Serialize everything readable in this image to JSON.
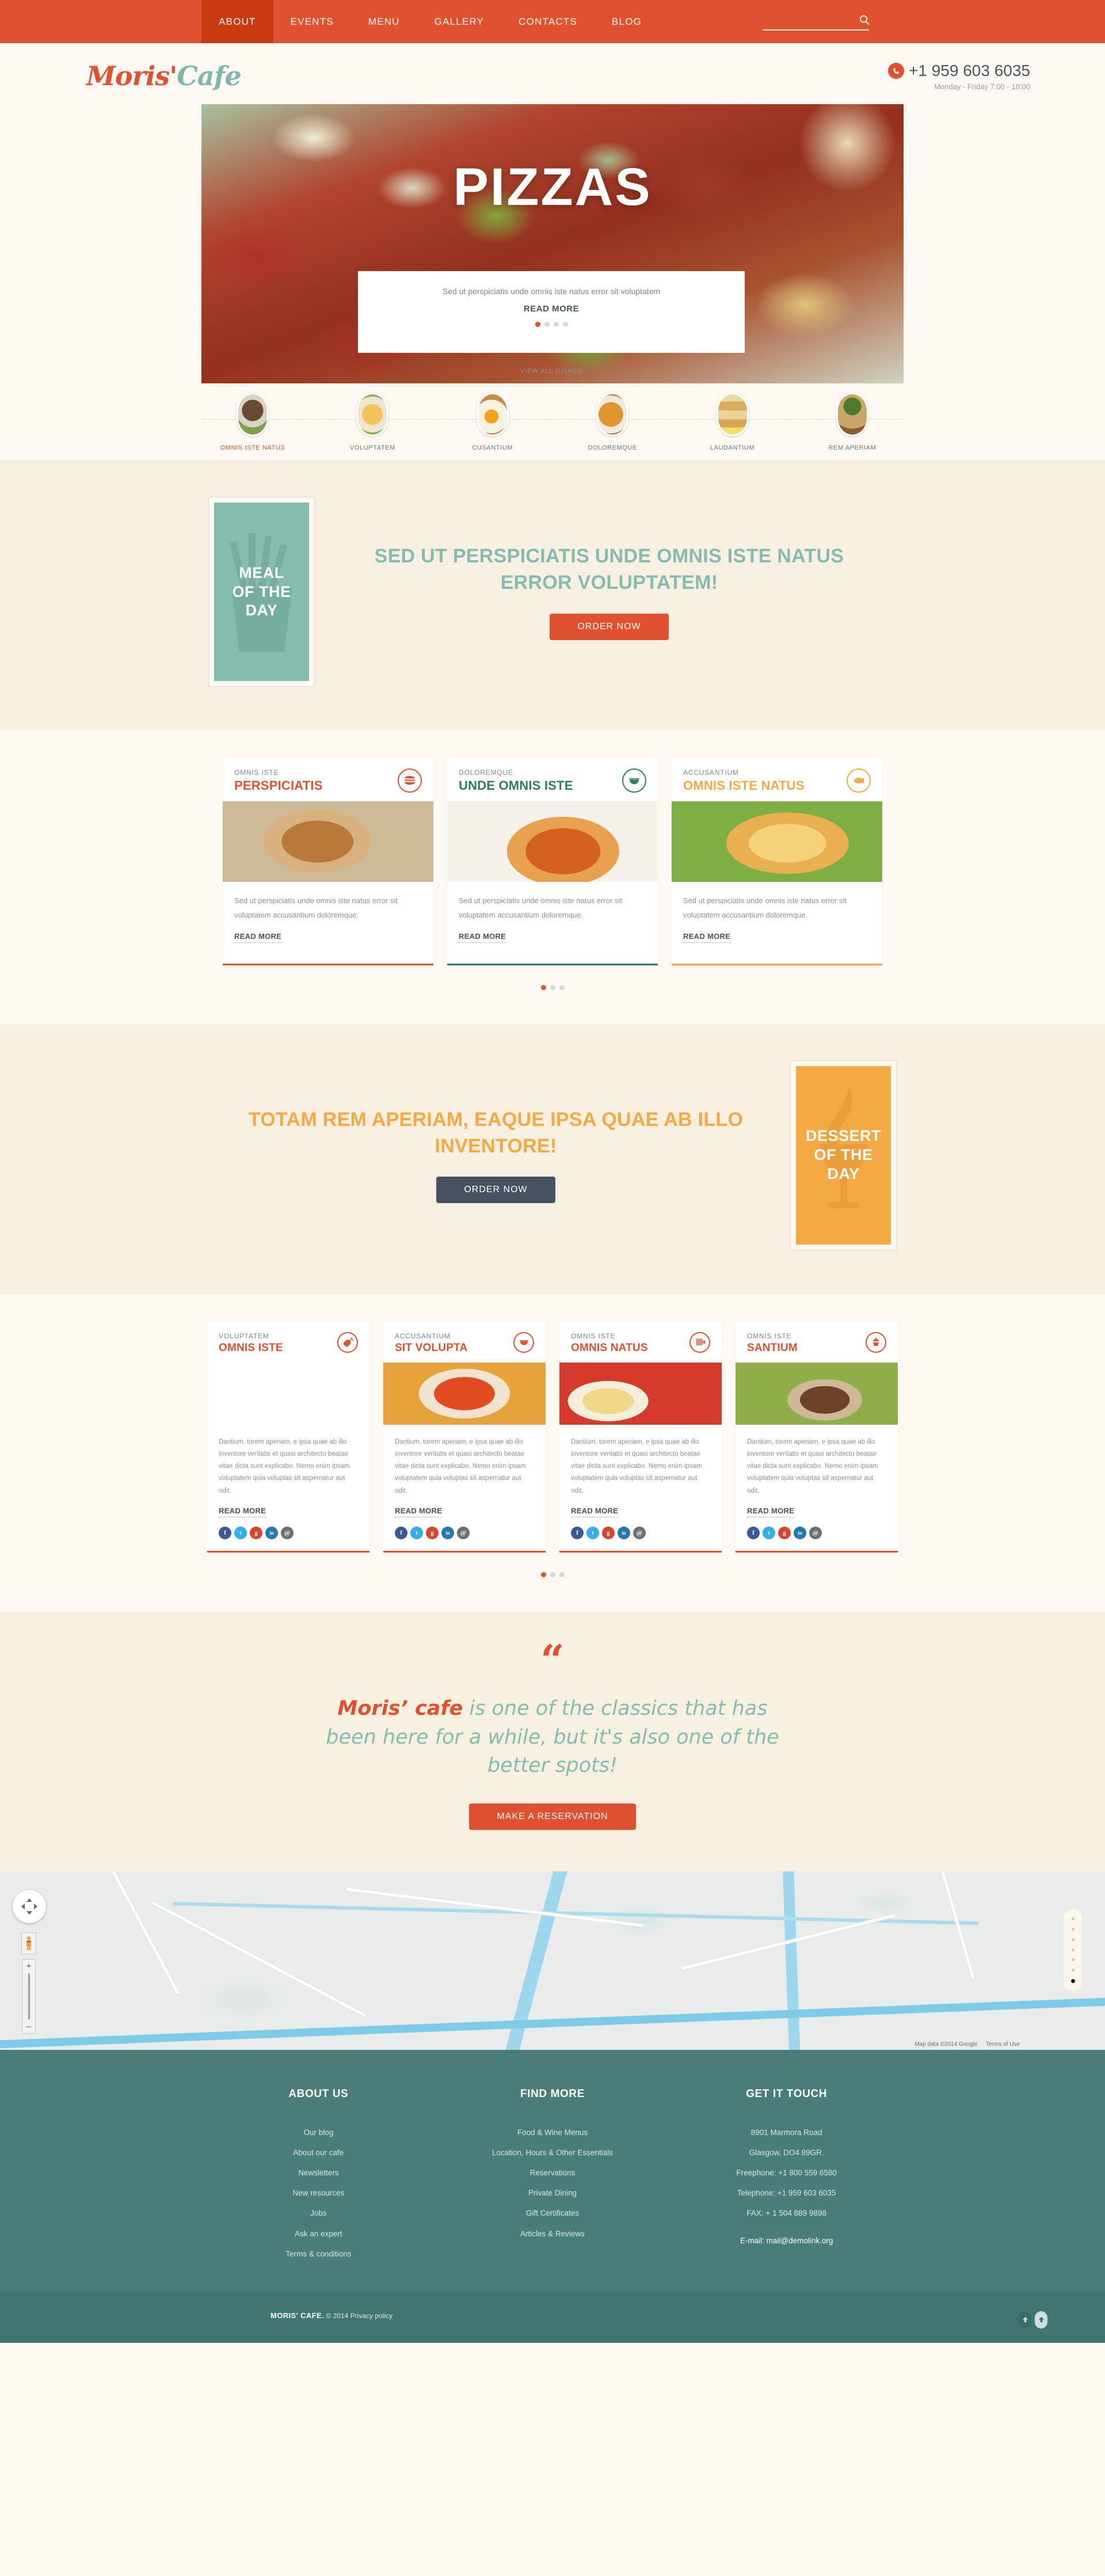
{
  "nav": {
    "items": [
      {
        "label": "ABOUT",
        "active": true
      },
      {
        "label": "EVENTS",
        "active": false
      },
      {
        "label": "MENU",
        "active": false
      },
      {
        "label": "GALLERY",
        "active": false
      },
      {
        "label": "CONTACTS",
        "active": false
      },
      {
        "label": "BLOG",
        "active": false
      }
    ],
    "search_placeholder": "",
    "search_value": ""
  },
  "brand": {
    "name_part1": "Moris'",
    "name_part2": "Cafe",
    "phone": "+1 959 603 6035",
    "hours": "Monday - Friday 7:00 - 18:00"
  },
  "hero": {
    "title": "PIZZAS",
    "lead": "Sed ut perspiciatis unde omnis iste natus error sit voluptatem",
    "read_more": "READ MORE",
    "view_all": "VIEW ALL DISHES",
    "dot_count": 4,
    "dot_active": 0
  },
  "categories": [
    {
      "label": "OMNIS ISTE NATUS",
      "active": true
    },
    {
      "label": "VOLUPTATEM",
      "active": false
    },
    {
      "label": "CUSANTIUM",
      "active": false
    },
    {
      "label": "DOLOREMQUE",
      "active": false
    },
    {
      "label": "LAUDANTIUM",
      "active": false
    },
    {
      "label": "REM APERIAM",
      "active": false
    }
  ],
  "promo_meal": {
    "box_label_line1": "MEAL",
    "box_label_line2": "OF THE DAY",
    "heading": "SED UT PERSPICIATIS UNDE OMNIS ISTE NATUS ERROR VOLUPTATEM!",
    "button": "ORDER NOW",
    "accent": "#84bdb0"
  },
  "promo_dessert": {
    "box_label_line1": "DESSERT",
    "box_label_line2": "OF THE DAY",
    "heading": "TOTAM REM APERIAM, EAQUE IPSA QUAE AB ILLO INVENTORE!",
    "button": "ORDER NOW",
    "accent": "#f4a942"
  },
  "dishes_three": {
    "cards": [
      {
        "kicker": "OMNIS ISTE",
        "title": "PERSPICIATIS",
        "desc": "Sed ut perspiciatis unde omnis iste natus error sit voluptatem accusantium doloremque.",
        "read_more": "READ MORE",
        "accent": "#e0512f",
        "icon": "burger-icon"
      },
      {
        "kicker": "DOLOREMQUE",
        "title": "UNDE OMNIS ISTE",
        "desc": "Sed ut perspiciatis unde omnis iste natus error sit voluptatem accusantium doloremque.",
        "read_more": "READ MORE",
        "accent": "#2e7d5b",
        "icon": "soup-icon"
      },
      {
        "kicker": "ACCUSANTIUM",
        "title": "OMNIS ISTE NATUS",
        "desc": "Sed ut perspiciatis unde omnis iste natus error sit voluptatem accusantium doloremque.",
        "read_more": "READ MORE",
        "accent": "#f4a942",
        "icon": "fish-icon"
      }
    ],
    "dot_count": 3,
    "dot_active": 0
  },
  "dishes_four": {
    "cards": [
      {
        "kicker": "VOLUPTATEM",
        "title": "OMNIS ISTE",
        "desc": "Dantium, torem aperiam, e ipsa quae ab illo inventore veritatis et quasi architecto beatae vitae dicta sunt explicabo. Nemo enim ipsam voluptatem quia voluptas sit aspernatur aut odit.",
        "read_more": "READ MORE",
        "accent": "#e0512f",
        "icon": "meat-leg-icon"
      },
      {
        "kicker": "ACCUSANTIUM",
        "title": "SIT VOLUPTA",
        "desc": "Dantium, torem aperiam, e ipsa quae ab illo inventore veritatis et quasi architecto beatae vitae dicta sunt explicabo. Nemo enim ipsam voluptatem quia voluptas sit aspernatur aut odit.",
        "read_more": "READ MORE",
        "accent": "#e0512f",
        "icon": "soup-icon"
      },
      {
        "kicker": "OMNIS ISTE",
        "title": "OMNIS NATUS",
        "desc": "Dantium, torem aperiam, e ipsa quae ab illo inventore veritatis et quasi architecto beatae vitae dicta sunt explicabo. Nemo enim ipsam voluptatem quia voluptas sit aspernatur aut odit.",
        "read_more": "READ MORE",
        "accent": "#e0512f",
        "icon": "pasta-icon"
      },
      {
        "kicker": "OMNIS ISTE",
        "title": "SANTIUM",
        "desc": "Dantium, torem aperiam, e ipsa quae ab illo inventore veritatis et quasi architecto beatae vitae dicta sunt explicabo. Nemo enim ipsam voluptatem quia voluptas sit aspernatur aut odit.",
        "read_more": "READ MORE",
        "accent": "#e0512f",
        "icon": "cupcake-icon"
      }
    ],
    "socials": [
      {
        "name": "facebook",
        "glyph": "f",
        "color": "#3b5998"
      },
      {
        "name": "twitter",
        "glyph": "t",
        "color": "#2fb0e8"
      },
      {
        "name": "googleplus",
        "glyph": "g",
        "color": "#d7452e"
      },
      {
        "name": "linkedin",
        "glyph": "in",
        "color": "#2079b5"
      },
      {
        "name": "email",
        "glyph": "@",
        "color": "#6e6e6e"
      }
    ],
    "dot_count": 3,
    "dot_active": 0
  },
  "quote": {
    "mark": "“",
    "brand": "Moris’ cafe",
    "rest": " is one of the classics that has been here for a while, but it's also one of the better spots!",
    "button": "MAKE A RESERVATION"
  },
  "map": {
    "attribution": "Map data ©2014 Google",
    "terms": "Terms of Use",
    "zoom_in": "+",
    "zoom_out": "–",
    "right_dot_count": 7,
    "right_dot_active": 6
  },
  "footer": {
    "columns": [
      {
        "heading": "ABOUT US",
        "links": [
          "Our blog",
          "About our cafe",
          "Newsletters",
          "New resources",
          "Jobs",
          "Ask an expert",
          "Terms & conditions"
        ]
      },
      {
        "heading": "FIND MORE",
        "links": [
          "Food & Wine Menus",
          "Location, Hours & Other Essentials",
          "Reservations",
          "Private Dining",
          "Gift Certificates",
          "Articles & Reviews"
        ]
      }
    ],
    "contact": {
      "heading": "GET IT TOUCH",
      "lines": [
        "8901 Marmora Road",
        "Glasgow, DO4 89GR.",
        "Freephone: +1 800 559 6580",
        "Telephone:  +1 959 603 6035",
        "FAX:       + 1 504 889 9898"
      ],
      "email": "E-mail: mail@demolink.org"
    },
    "copyright_brand": "MORIS' CAFE.",
    "copyright_rest": " © 2014 ",
    "copyright_link": "Privacy policy"
  }
}
